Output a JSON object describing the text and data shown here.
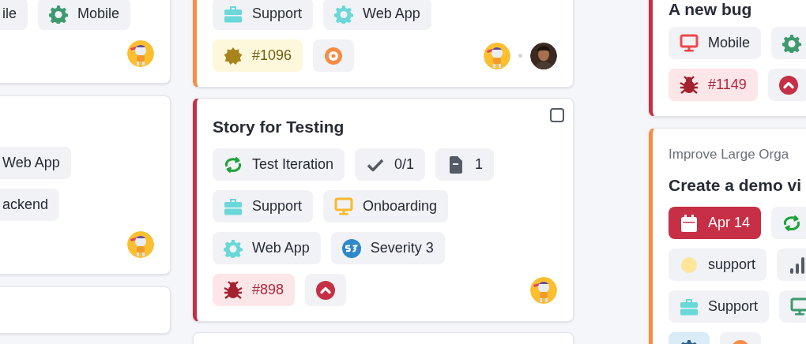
{
  "columns": [
    {
      "next_card_peek": true,
      "cards": [
        {
          "rows": [
            {
              "chips": [
                {
                  "kind": "plain",
                  "text": "ile"
                },
                {
                  "kind": "gear",
                  "color": "#3c9a6e",
                  "text": "Mobile"
                }
              ]
            },
            {
              "avatars": [
                {
                  "kind": "mascot"
                }
              ]
            }
          ]
        },
        {
          "rows": [
            {
              "chips": [
                {
                  "kind": "plain",
                  "text": "Web App"
                }
              ]
            },
            {
              "chips": [
                {
                  "kind": "plain",
                  "text": "ackend"
                }
              ]
            },
            {
              "avatars": [
                {
                  "kind": "mascot"
                }
              ]
            }
          ]
        }
      ]
    },
    {
      "next_card_peek": true,
      "cards": [
        {
          "color": "#f68d45",
          "rows": [
            {
              "chips": [
                {
                  "kind": "briefcase",
                  "color": "#6ad8d8",
                  "text": "Support"
                },
                {
                  "kind": "gear",
                  "color": "#6ad8d8",
                  "text": "Web App"
                }
              ]
            },
            {
              "chips": [
                {
                  "kind": "story",
                  "color": "#a8841d",
                  "text": "#1096"
                },
                {
                  "kind": "target",
                  "color": "#f68d45"
                }
              ],
              "avatars": [
                {
                  "kind": "mascot"
                },
                {
                  "kind": "photo"
                }
              ]
            }
          ]
        },
        {
          "color": "#c62f45",
          "title": "Story for Testing",
          "checkbox": {
            "checked": false
          },
          "rows": [
            {
              "chips": [
                {
                  "kind": "cycle",
                  "color": "#1fa33a",
                  "text": "Test Iteration"
                },
                {
                  "kind": "check",
                  "color": "#555b66",
                  "text": "0/1"
                },
                {
                  "kind": "file",
                  "color": "#555b66",
                  "text": "1"
                }
              ]
            },
            {
              "chips": [
                {
                  "kind": "briefcase",
                  "color": "#6ad8d8",
                  "text": "Support"
                },
                {
                  "kind": "monitor",
                  "color": "#f8b92c",
                  "text": "Onboarding"
                }
              ]
            },
            {
              "chips": [
                {
                  "kind": "gear",
                  "color": "#6ad8d8",
                  "text": "Web App"
                },
                {
                  "kind": "severity",
                  "color": "#2f88c9",
                  "text": "Severity 3"
                }
              ]
            },
            {
              "chips": [
                {
                  "kind": "bug",
                  "color": "#a3222f",
                  "text": "#898"
                },
                {
                  "kind": "priority",
                  "color": "#c62f45"
                }
              ],
              "avatars": [
                {
                  "kind": "mascot"
                }
              ]
            }
          ]
        }
      ]
    },
    {
      "cards": [
        {
          "color": "#c62f45",
          "title": "A new bug",
          "rows": [
            {
              "chips": [
                {
                  "kind": "monitor",
                  "color": "#f0474a",
                  "text": "Mobile"
                },
                {
                  "kind": "gear",
                  "color": "#3c9a6e"
                }
              ]
            },
            {
              "chips": [
                {
                  "kind": "bug",
                  "color": "#a3222f",
                  "text": "#1149"
                },
                {
                  "kind": "priority",
                  "color": "#c62f45"
                }
              ]
            }
          ]
        },
        {
          "color": "#f68d45",
          "subtitle": "Improve Large Orga",
          "title": "Create a demo vi",
          "rows": [
            {
              "chips": [
                {
                  "kind": "date",
                  "color": "#ffffff",
                  "text": "Apr 14"
                },
                {
                  "kind": "cycle",
                  "color": "#1fa33a"
                }
              ]
            },
            {
              "chips": [
                {
                  "kind": "label",
                  "color": "#fde59a",
                  "text": "support"
                },
                {
                  "kind": "bars",
                  "color": "#555b66"
                }
              ]
            },
            {
              "chips": [
                {
                  "kind": "briefcase",
                  "color": "#6ad8d8",
                  "text": "Support"
                },
                {
                  "kind": "monitor",
                  "color": "#3c9a6e"
                }
              ]
            },
            {
              "chips": [
                {
                  "kind": "team",
                  "color": "#2a5d8a"
                },
                {
                  "kind": "target",
                  "color": "#f68d45"
                }
              ]
            }
          ]
        }
      ]
    }
  ]
}
